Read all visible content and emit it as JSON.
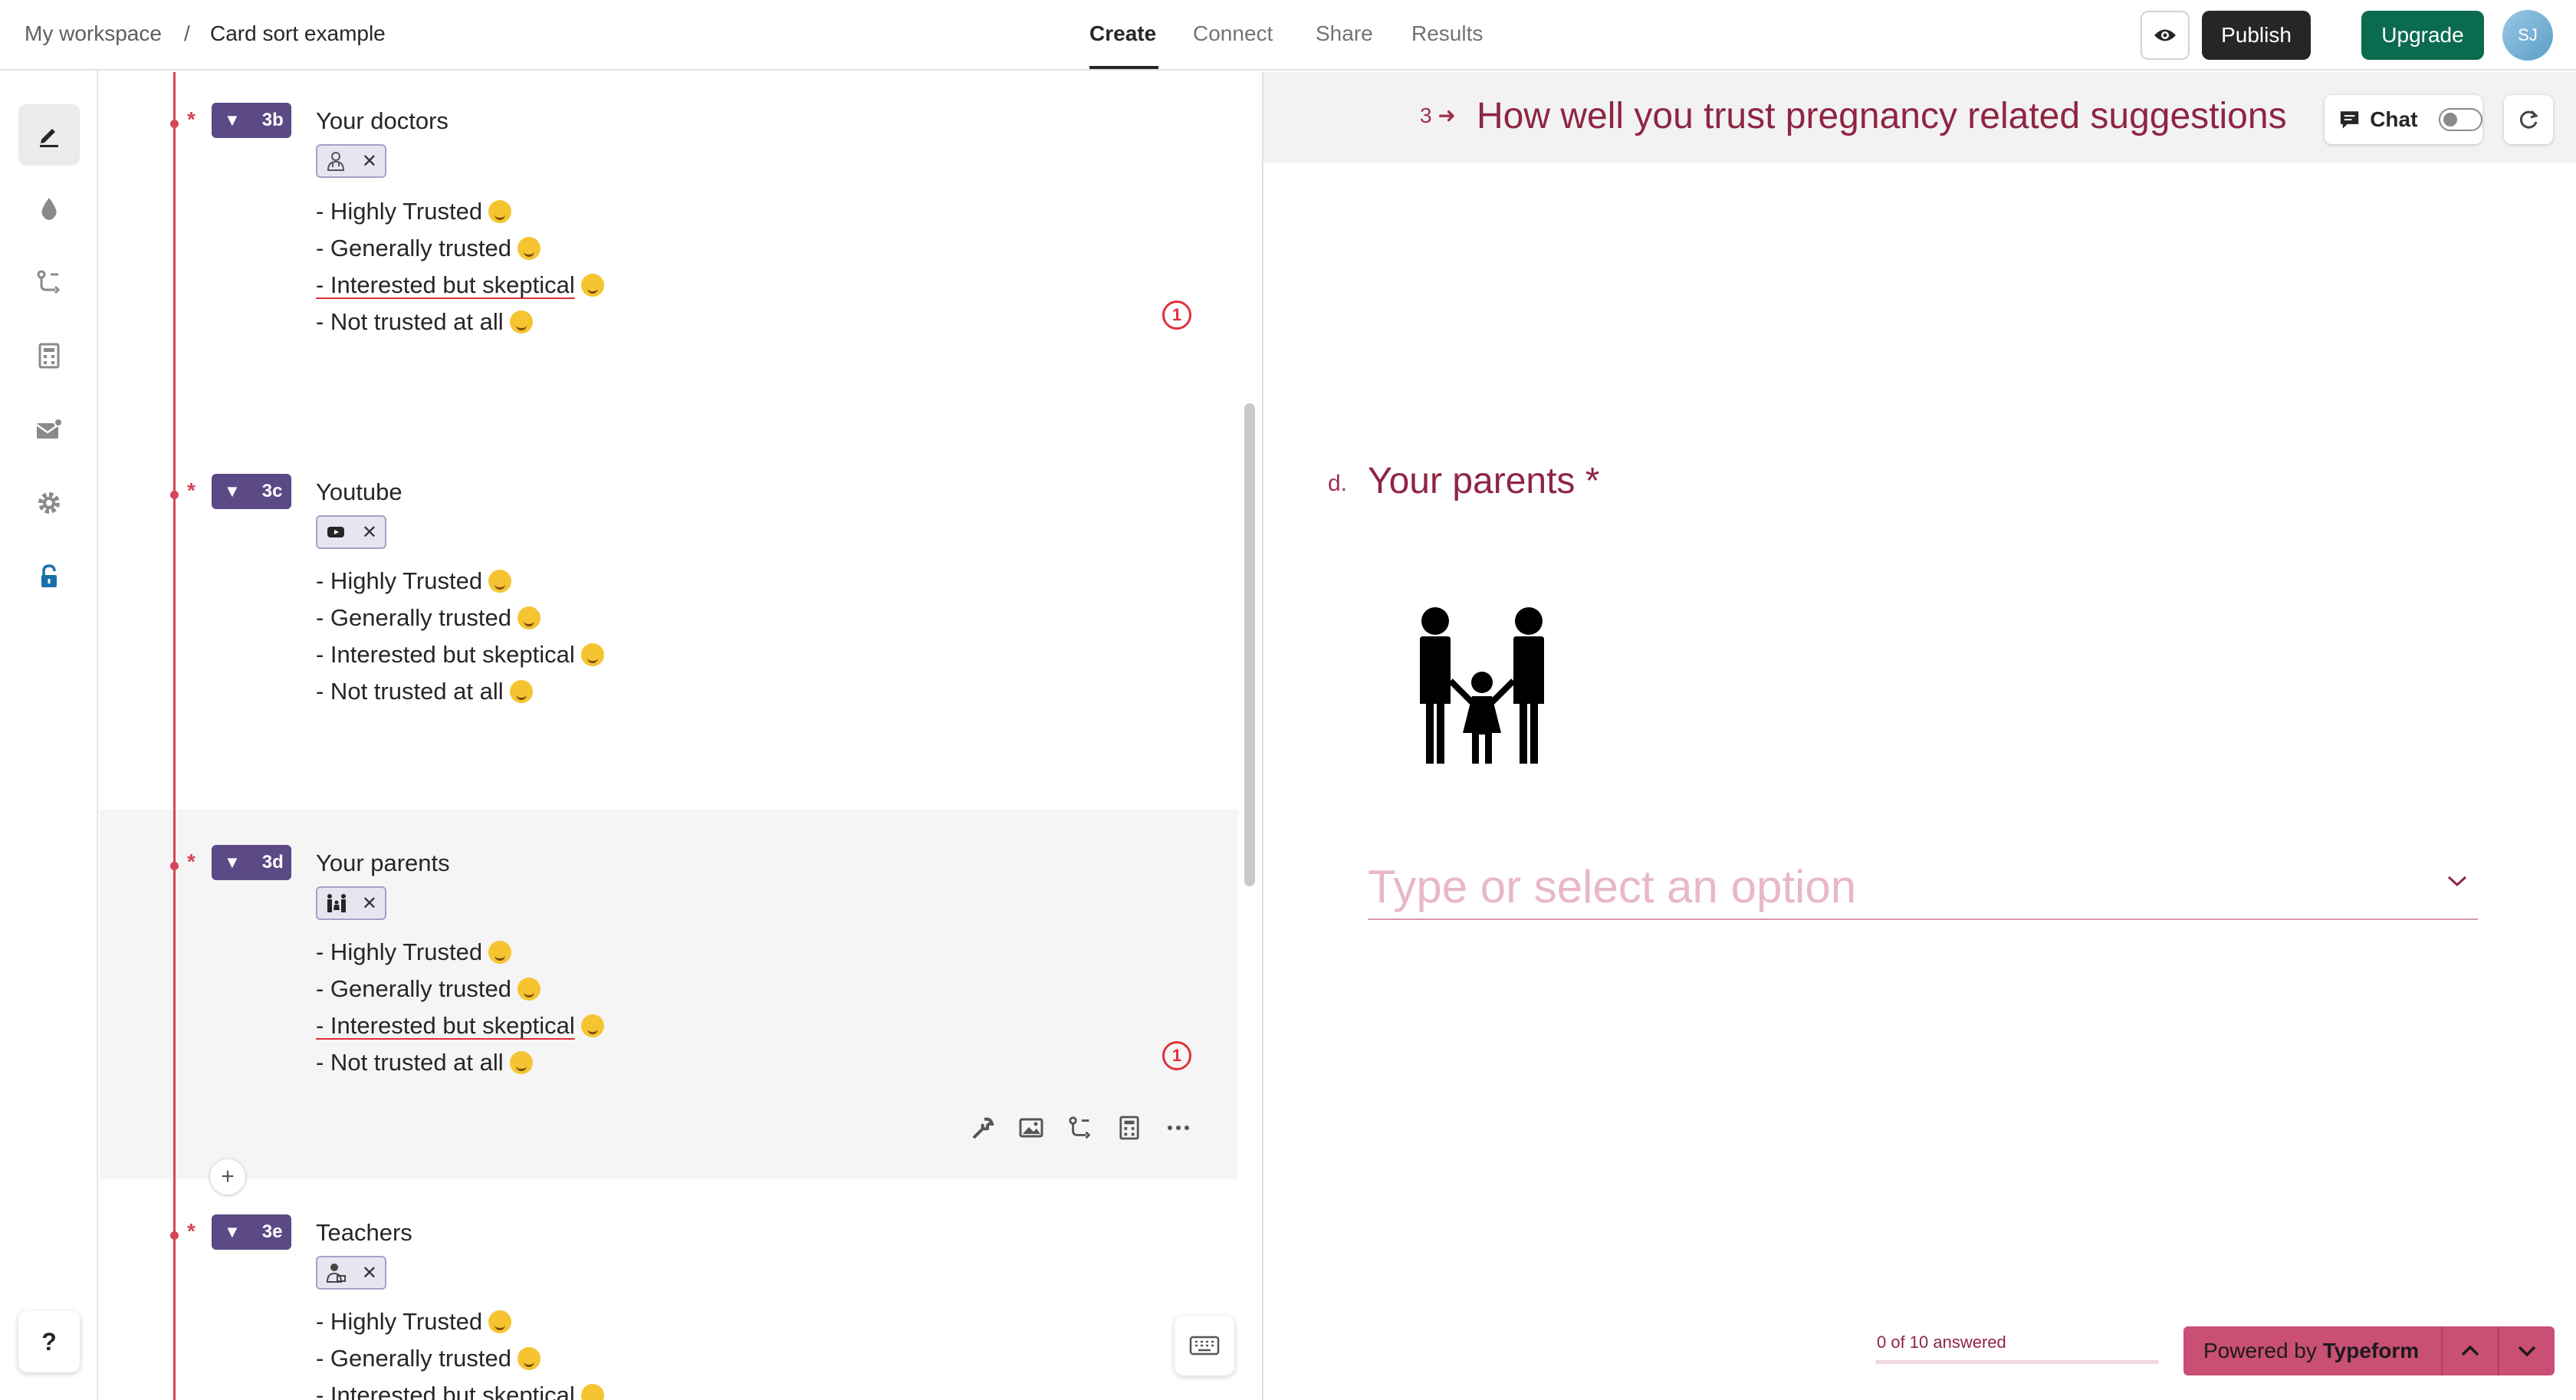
{
  "breadcrumb": {
    "workspace": "My workspace",
    "separator": "/",
    "form": "Card sort example"
  },
  "nav": {
    "tabs": [
      "Create",
      "Connect",
      "Share",
      "Results"
    ],
    "active": "Create"
  },
  "actions": {
    "preview_icon": "eye-icon",
    "publish": "Publish",
    "upgrade": "Upgrade",
    "avatar_initials": "SJ"
  },
  "rail": {
    "items": [
      "edit-icon",
      "theme-drop-icon",
      "logic-icon",
      "calculator-icon",
      "email-icon",
      "settings-icon",
      "lock-icon"
    ],
    "help": "?"
  },
  "questions": [
    {
      "badge": "3b",
      "title": "Your doctors",
      "chip_icon": "doctor-icon",
      "warning": "1",
      "options": [
        "- Highly Trusted",
        "- Generally trusted",
        "- Interested but skeptical",
        "- Not trusted at all"
      ]
    },
    {
      "badge": "3c",
      "title": "Youtube",
      "chip_icon": "youtube-icon",
      "options": [
        "- Highly Trusted",
        "- Generally trusted",
        "- Interested but skeptical",
        "- Not trusted at all"
      ]
    },
    {
      "badge": "3d",
      "title": "Your parents",
      "chip_icon": "family-icon",
      "warning": "1",
      "options": [
        "- Highly Trusted",
        "- Generally trusted",
        "- Interested but skeptical",
        "- Not trusted at all"
      ]
    },
    {
      "badge": "3e",
      "title": "Teachers",
      "chip_icon": "teacher-icon",
      "options": [
        "- Highly Trusted",
        "- Generally trusted",
        "- Interested but skeptical"
      ]
    }
  ],
  "required_mark": "*",
  "add_button": "+",
  "preview": {
    "question_number": "3",
    "title": "How well you trust pregnancy related suggestions",
    "chat_label": "Chat",
    "sub_letter": "d.",
    "sub_question": "Your parents *",
    "input_placeholder": "Type or select an option",
    "progress": "0 of 10 answered",
    "answered_fraction": 0,
    "powered_by_prefix": "Powered by",
    "powered_by_brand": "Typeform"
  },
  "colors": {
    "accent": "#8f2543",
    "badge": "#5b4a86",
    "publish": "#262627",
    "upgrade": "#0b6b4f",
    "required": "#d6455a"
  }
}
